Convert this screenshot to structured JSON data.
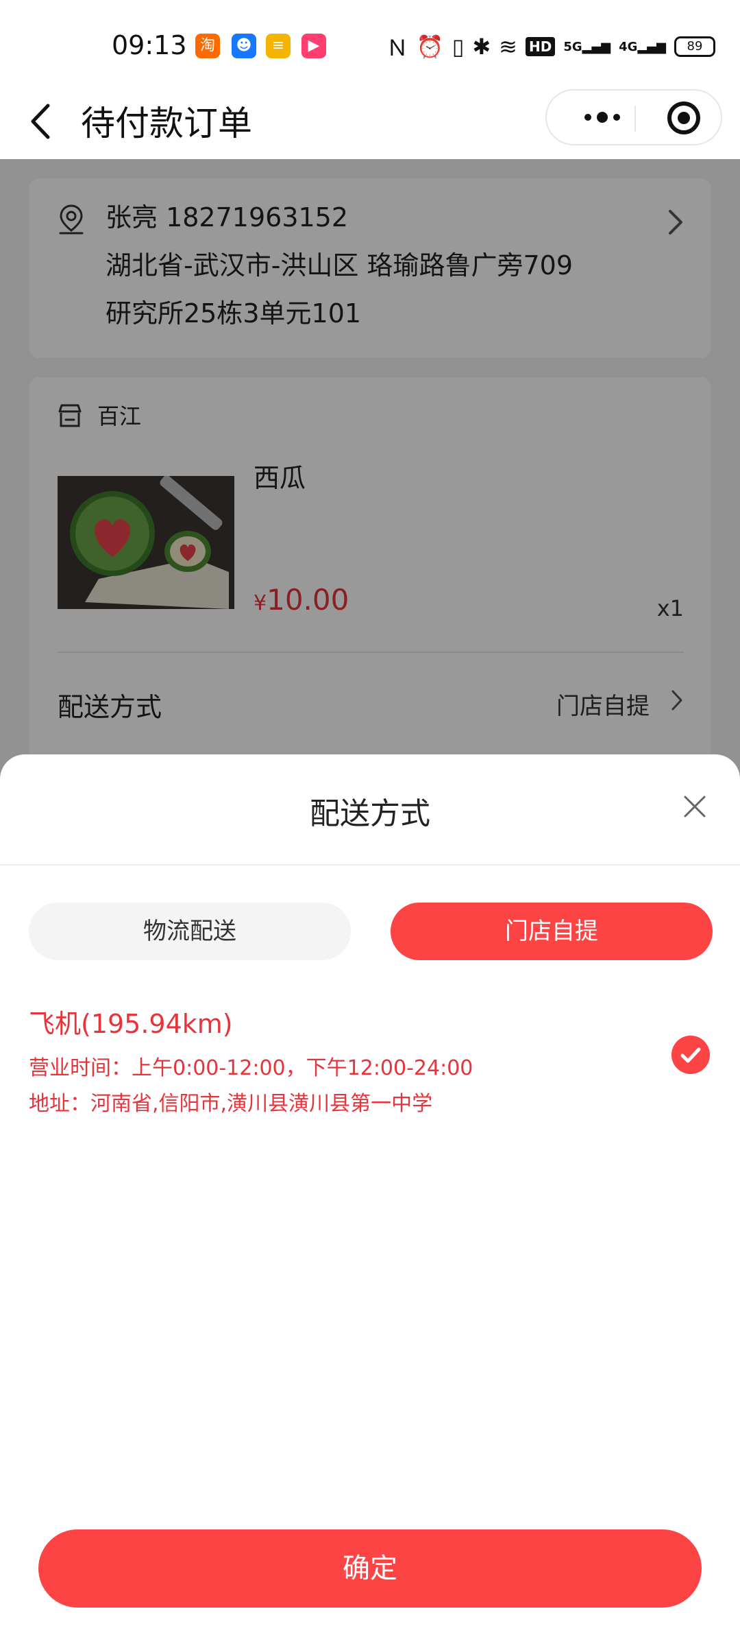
{
  "status_bar": {
    "time": "09:13",
    "app_icons": [
      {
        "name": "taobao-icon",
        "glyph": "淘",
        "color": "#ff6a00"
      },
      {
        "name": "chat-app-icon",
        "glyph": "☻",
        "color": "#1677ff"
      },
      {
        "name": "wallet-app-icon",
        "glyph": "≡",
        "color": "#f4b400"
      },
      {
        "name": "video-app-icon",
        "glyph": "▶",
        "color": "#ff3d6e"
      }
    ],
    "hd_label": "HD",
    "net_5g": "5G",
    "net_4g": "4G",
    "battery": "89"
  },
  "navbar": {
    "title": "待付款订单"
  },
  "address": {
    "name_phone": "张亮 18271963152",
    "line1": "湖北省-武汉市-洪山区 珞瑜路鲁广旁709",
    "line2": "研究所25栋3单元101"
  },
  "shop": {
    "store_name": "百江",
    "product_name": "西瓜",
    "currency": "¥",
    "price": "10.00",
    "quantity": "x1",
    "shipping_label": "配送方式",
    "shipping_value": "门店自提"
  },
  "sheet": {
    "title": "配送方式",
    "options": [
      "物流配送",
      "门店自提"
    ],
    "selected_option": "门店自提",
    "store": {
      "name": "飞机(195.94km)",
      "hours": "营业时间：上午0:00-12:00，下午12:00-24:00",
      "address": "地址：河南省,信阳市,潢川县潢川县第一中学"
    },
    "confirm_label": "确定"
  },
  "colors": {
    "accent": "#fd4445",
    "price": "#e8333b",
    "overlay": "rgba(0,0,0,0.40)"
  }
}
